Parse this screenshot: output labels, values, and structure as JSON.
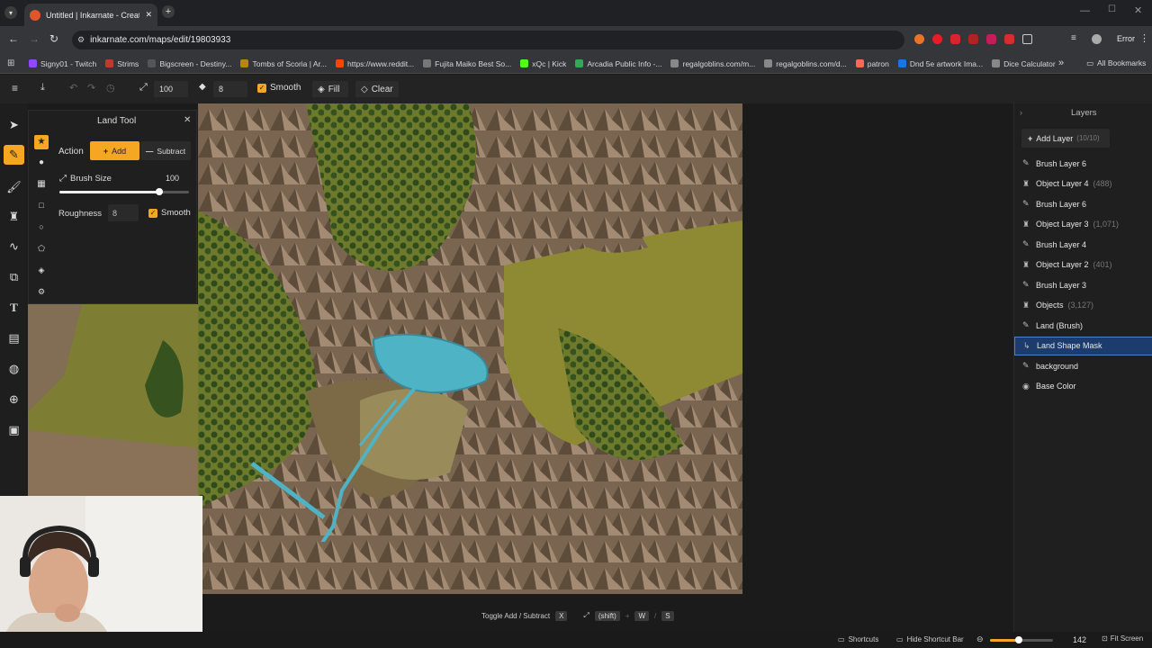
{
  "browser": {
    "tab_title": "Untitled | Inkarnate - Create Fa",
    "url": "inkarnate.com/maps/edit/19803933",
    "error_label": "Error",
    "bookmarks": [
      {
        "label": "Signy01 - Twitch",
        "color": "#9146ff"
      },
      {
        "label": "Strims",
        "color": "#c0392b"
      },
      {
        "label": "Bigscreen - Destiny...",
        "color": "#555555"
      },
      {
        "label": "Tombs of Scoria | Ar...",
        "color": "#b8860b"
      },
      {
        "label": "https://www.reddit...",
        "color": "#ff4500"
      },
      {
        "label": "Fujita Maiko Best So...",
        "color": "#777777"
      },
      {
        "label": "xQc | Kick",
        "color": "#53fc18"
      },
      {
        "label": "Arcadia Public Info -...",
        "color": "#34a853"
      },
      {
        "label": "regalgoblins.com/m...",
        "color": "#888888"
      },
      {
        "label": "regalgoblins.com/d...",
        "color": "#888888"
      },
      {
        "label": "patron",
        "color": "#f96854"
      },
      {
        "label": "Dnd 5e artwork Ima...",
        "color": "#1a73e8"
      },
      {
        "label": "Dice Calculator",
        "color": "#888888"
      }
    ],
    "all_bookmarks": "All Bookmarks"
  },
  "toolbar": {
    "brush_size": "100",
    "roughness": "8",
    "smooth_label": "Smooth",
    "fill_label": "Fill",
    "clear_label": "Clear"
  },
  "land_tool": {
    "title": "Land Tool",
    "action_label": "Action",
    "add_label": "Add",
    "subtract_label": "Subtract",
    "brush_size_label": "Brush Size",
    "brush_size_value": "100",
    "brush_size_fraction": 0.77,
    "roughness_label": "Roughness",
    "roughness_value": "8",
    "smooth_label": "Smooth"
  },
  "layers": {
    "title": "Layers",
    "add_layer_label": "Add Layer",
    "add_layer_count": "(10/10)",
    "items": [
      {
        "name": "Brush Layer 6",
        "count": "",
        "icon": "brush-icon",
        "selected": false
      },
      {
        "name": "Object Layer 4",
        "count": "(488)",
        "icon": "object-icon",
        "selected": false
      },
      {
        "name": "Brush Layer 6",
        "count": "",
        "icon": "brush-icon",
        "selected": false
      },
      {
        "name": "Object Layer 3",
        "count": "(1,071)",
        "icon": "object-icon",
        "selected": false
      },
      {
        "name": "Brush Layer 4",
        "count": "",
        "icon": "brush-icon",
        "selected": false
      },
      {
        "name": "Object Layer 2",
        "count": "(401)",
        "icon": "object-icon",
        "selected": false
      },
      {
        "name": "Brush Layer 3",
        "count": "",
        "icon": "brush-icon",
        "selected": false
      },
      {
        "name": "Objects",
        "count": "(3,127)",
        "icon": "object-icon",
        "selected": false
      },
      {
        "name": "Land (Brush)",
        "count": "",
        "icon": "brush-icon",
        "selected": false
      },
      {
        "name": "Land Shape Mask",
        "count": "",
        "icon": "mask-icon",
        "selected": true
      },
      {
        "name": "background",
        "count": "",
        "icon": "brush-icon",
        "selected": false
      },
      {
        "name": "Base Color",
        "count": "",
        "icon": "palette-icon",
        "selected": false
      }
    ]
  },
  "shortcut_hint": {
    "label": "Toggle Add / Subtract",
    "key1": "X",
    "key2": "(shift)",
    "sep1": "+",
    "key3": "W",
    "sep2": "/",
    "key4": "S"
  },
  "statusbar": {
    "shortcuts_label": "Shortcuts",
    "hide_label": "Hide Shortcut Bar",
    "zoom_value": "142",
    "zoom_fraction": 0.45,
    "fit_label": "Fit Screen"
  }
}
